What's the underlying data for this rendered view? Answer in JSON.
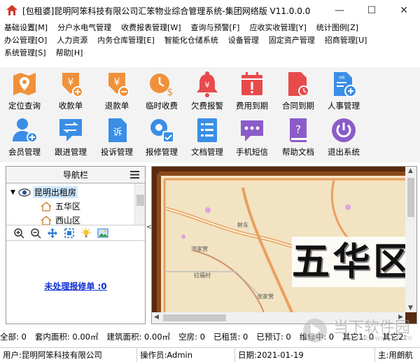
{
  "window": {
    "title": "[包租婆]昆明阿笨科技有限公司汇笨物业综合管理系统-集团网络版 V11.0.0.0",
    "min": "—",
    "max": "☐",
    "close": "✕"
  },
  "menu": {
    "row1": [
      "基础设置[M]",
      "分户水电气管理",
      "收费报表管理[W]",
      "查询与预警[F]",
      "应收实收管理[Y]",
      "统计图例[Z]"
    ],
    "row2": [
      "办公管理[O]",
      "人力资源",
      "内务仓库管理[E]",
      "智能化仓储系统",
      "设备管理",
      "固定资产管理",
      "招商管理[U]"
    ],
    "row3": [
      "系统管理[S]",
      "帮助[H]"
    ]
  },
  "toolbar": {
    "row1": [
      {
        "label": "定位查询",
        "icon": "map-pin-icon",
        "color": "#f0913a"
      },
      {
        "label": "收款单",
        "icon": "yen-plus-icon",
        "color": "#f0913a"
      },
      {
        "label": "退款单",
        "icon": "yen-minus-icon",
        "color": "#f0913a"
      },
      {
        "label": "临时收费",
        "icon": "clock-yen-icon",
        "color": "#f0913a"
      },
      {
        "label": "欠费报警",
        "icon": "bell-icon",
        "color": "#e84b4b"
      },
      {
        "label": "费用到期",
        "icon": "calendar-alert-icon",
        "color": "#e84b4b"
      },
      {
        "label": "合同到期",
        "icon": "document-clock-icon",
        "color": "#e84b4b"
      },
      {
        "label": "人事管理",
        "icon": "hr-document-icon",
        "color": "#3a8ee6"
      }
    ],
    "row2": [
      {
        "label": "会员管理",
        "icon": "add-member-icon",
        "color": "#3a8ee6"
      },
      {
        "label": "跟进管理",
        "icon": "follow-up-icon",
        "color": "#3a8ee6"
      },
      {
        "label": "投诉管理",
        "icon": "complaint-icon",
        "color": "#3a8ee6"
      },
      {
        "label": "报修管理",
        "icon": "repair-gear-icon",
        "color": "#3a8ee6"
      },
      {
        "label": "文档管理",
        "icon": "document-list-icon",
        "color": "#3a8ee6"
      },
      {
        "label": "手机短信",
        "icon": "sms-icon",
        "color": "#8b5cc8"
      },
      {
        "label": "帮助文档",
        "icon": "help-book-icon",
        "color": "#8b5cc8"
      },
      {
        "label": "退出系统",
        "icon": "power-icon",
        "color": "#8b5cc8"
      }
    ]
  },
  "nav": {
    "title": "导航栏",
    "root": "昆明出租房",
    "children": [
      "五华区",
      "西山区"
    ],
    "pending_link": "未处理报修单 :0"
  },
  "map": {
    "district_label": "五华区",
    "place_labels": [
      "洪家营",
      "鲜东",
      "拉福村",
      "张家营"
    ]
  },
  "status1": [
    "全部: 0",
    "套内面积: 0.00㎡",
    "建筑面积: 0.00㎡",
    "空房: 0",
    "已租赁: 0",
    "已预订: 0",
    "维修中: 0",
    "其它1: 0",
    "其它2:"
  ],
  "status2": {
    "user": "用户:昆明阿笨科技有限公司",
    "operator": "操作员:Admin",
    "date": "日期:2021-01-19",
    "note": "主:用朗航"
  },
  "watermark": {
    "text": "当下软件园",
    "url": "www.downxia.com"
  }
}
